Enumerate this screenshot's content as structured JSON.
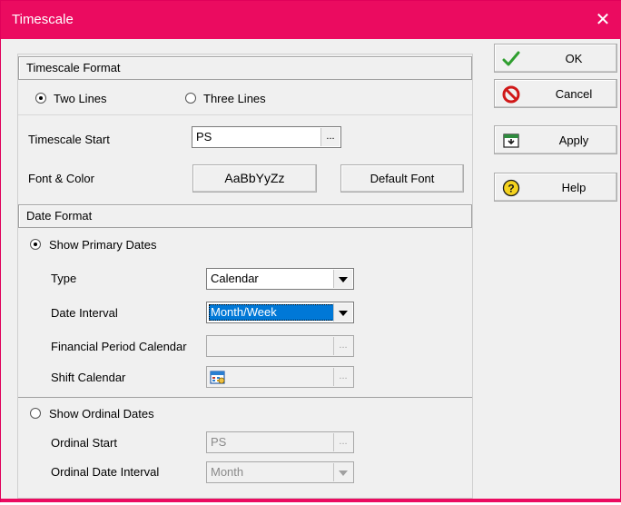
{
  "window": {
    "title": "Timescale"
  },
  "buttons": {
    "ok": "OK",
    "cancel": "Cancel",
    "apply": "Apply",
    "help": "Help"
  },
  "timescale_format": {
    "header": "Timescale Format",
    "two_lines": "Two Lines",
    "three_lines": "Three Lines",
    "selected": "Two Lines",
    "start_label": "Timescale Start",
    "start_value": "PS",
    "font_label": "Font & Color",
    "font_sample": "AaBbYyZz",
    "default_font": "Default Font"
  },
  "date_format": {
    "header": "Date Format",
    "primary_label": "Show Primary Dates",
    "type_label": "Type",
    "type_value": "Calendar",
    "interval_label": "Date Interval",
    "interval_value": "Month/Week",
    "fin_label": "Financial Period Calendar",
    "fin_value": "",
    "shift_label": "Shift Calendar",
    "ordinal_label": "Show Ordinal Dates",
    "ord_start_label": "Ordinal Start",
    "ord_start_value": "PS",
    "ord_interval_label": "Ordinal Date Interval",
    "ord_interval_value": "Month",
    "ellipsis": "..."
  },
  "colors": {
    "titlebar": "#eb0b60",
    "selection": "#0078d7"
  },
  "icons": {
    "close": "close-icon",
    "ok": "checkmark-icon",
    "cancel": "no-entry-icon",
    "apply": "apply-icon",
    "help": "help-icon",
    "shift": "calendar-icon"
  }
}
